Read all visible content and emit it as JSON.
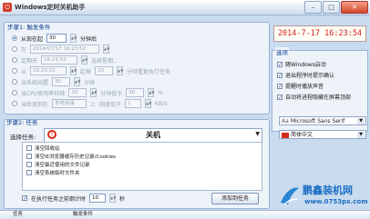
{
  "window": {
    "title": "Windows定时关机助手"
  },
  "trigger": {
    "section_title": "步骤1: 触发条件",
    "from_now": {
      "label": "从现在起",
      "value": "30",
      "unit": "分钟后"
    },
    "at_time": {
      "label": "在",
      "value": "2014/07/17 16:23:52"
    },
    "weekly": {
      "label": "定期天",
      "value": "16:23:52",
      "suffix": "选择星期..."
    },
    "from_day": {
      "label": "从",
      "value": "16:23:52",
      "mid": "起每",
      "value2": "30",
      "suffix": "分钟重复执行任务"
    },
    "idle": {
      "label": "当系统闲置",
      "value": "30",
      "unit": "分钟"
    },
    "cpu": {
      "label": "当CPU使用率持续",
      "value": "30",
      "mid": "分钟低于",
      "value2": "30",
      "unit": "%"
    },
    "net": {
      "label": "当检测到在",
      "dropdown": "本地连接",
      "mid": "上",
      "suffix": "网速低于",
      "value": "1",
      "unit": "KB/S"
    }
  },
  "clock": {
    "datetime": "2014-7-17 16:23:54"
  },
  "options": {
    "title": "选项",
    "items": [
      {
        "label": "随Windows启动",
        "checked": true
      },
      {
        "label": "退出程序时提示确认",
        "checked": true
      },
      {
        "label": "提醒时播放声音",
        "checked": true
      },
      {
        "label": "自动将进程隐藏在屏幕顶部",
        "checked": true
      }
    ],
    "font_select": "Microsoft Sans Serif",
    "lang_select": "简体中文"
  },
  "task": {
    "section_title": "步骤2: 任务",
    "select_label": "选择任务:",
    "selected": "关机",
    "sub_items": [
      "清空回收站",
      "清空IE浏览器缓存历史记录/Cookies",
      "清空最近使用的文件记录",
      "清空系统临时文件夹"
    ],
    "prompt": {
      "label": "在执行任务之前倒计时",
      "value": "10",
      "unit": "秒"
    },
    "add_button": "添加到任务"
  },
  "table": {
    "col1": "任务",
    "col2": "触发条件"
  },
  "watermark": {
    "brand": "鹏鑫装机网",
    "url": "www.0753px.com"
  },
  "colors": {
    "clock_text": "#d2241d",
    "title_blue": "#0b3b8c",
    "accent_red": "#d42b1e"
  }
}
